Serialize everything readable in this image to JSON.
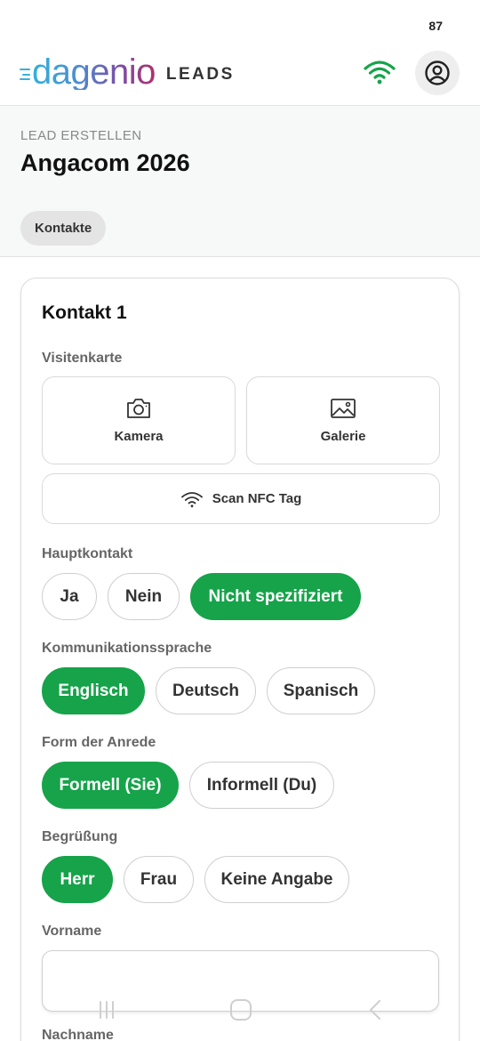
{
  "status_bar": {
    "battery": "87"
  },
  "header": {
    "logo_text": "dagenio",
    "logo_suffix": "LEADS",
    "brand_colors": [
      "#2fb3dc",
      "#4a8fd0",
      "#7a4fa8",
      "#b0306b"
    ],
    "wifi_icon": "wifi-icon",
    "wifi_color": "#16a34a",
    "avatar_icon": "user-circle-icon"
  },
  "page": {
    "kicker": "LEAD ERSTELLEN",
    "title": "Angacom 2026",
    "tabs": [
      {
        "label": "Kontakte",
        "selected": true
      }
    ]
  },
  "contact": {
    "title": "Kontakt 1",
    "business_card": {
      "label": "Visitenkarte",
      "camera_label": "Kamera",
      "camera_icon": "camera-icon",
      "gallery_label": "Galerie",
      "gallery_icon": "image-icon",
      "nfc_label": "Scan NFC Tag",
      "nfc_icon": "wifi-icon"
    },
    "main_contact": {
      "label": "Hauptkontakt",
      "options": [
        "Ja",
        "Nein",
        "Nicht spezifiziert"
      ],
      "selected": "Nicht spezifiziert"
    },
    "language": {
      "label": "Kommunikationssprache",
      "options": [
        "Englisch",
        "Deutsch",
        "Spanisch"
      ],
      "selected": "Englisch"
    },
    "address_form": {
      "label": "Form der Anrede",
      "options": [
        "Formell (Sie)",
        "Informell (Du)"
      ],
      "selected": "Formell (Sie)"
    },
    "greeting": {
      "label": "Begrüßung",
      "options": [
        "Herr",
        "Frau",
        "Keine Angabe"
      ],
      "selected": "Herr"
    },
    "first_name": {
      "label": "Vorname",
      "value": ""
    },
    "last_name": {
      "label": "Nachname"
    }
  },
  "accent_color": "#16a34a",
  "nav_bar": {
    "recents_icon": "recents-icon",
    "home_icon": "home-icon",
    "back_icon": "back-icon"
  }
}
